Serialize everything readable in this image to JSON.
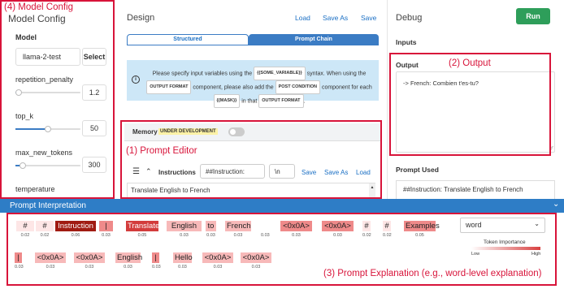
{
  "annotations": {
    "model_config": "(4) Model Config",
    "output": "(2) Output",
    "prompt_editor": "(1) Prompt Editor",
    "prompt_explanation": "(3) Prompt Explanation (e.g., word-level explanation)"
  },
  "config": {
    "title": "Model Config",
    "model_label": "Model",
    "model_value": "llama-2-test",
    "select_label": "Select",
    "params": [
      {
        "label": "repetition_penalty",
        "value": "1.2",
        "level": 0.05
      },
      {
        "label": "top_k",
        "value": "50",
        "level": 0.3
      },
      {
        "label": "max_new_tokens",
        "value": "300",
        "level": 0.1
      },
      {
        "label": "temperature",
        "value": "",
        "level": 0
      }
    ]
  },
  "design": {
    "title": "Design",
    "load": "Load",
    "save_as": "Save As",
    "save": "Save",
    "tab_structured": "Structured",
    "tab_chain": "Prompt Chain",
    "info_p1": "Please specify input variables using the",
    "info_tag1": "{{SOME_VARIABLE}}",
    "info_p2": "syntax. When using the",
    "info_tag2": "OUTPUT FORMAT",
    "info_p3": "component, please also add the",
    "info_tag3": "POST CONDITION",
    "info_p4": "component for each",
    "info_tag4": "{{MASK}}",
    "info_p5": "in that",
    "info_tag5": "OUTPUT FORMAT",
    "info_p6": ".",
    "memory_label": "Memory",
    "memory_badge": "UNDER DEVELOPMENT",
    "instr_label": "Instructions",
    "instr_field": "##Instruction:",
    "sep_field": "\\n",
    "instr_save": "Save",
    "instr_save_as": "Save As",
    "instr_load": "Load",
    "instr_text": "Translate English to French"
  },
  "debug": {
    "title": "Debug",
    "run": "Run",
    "inputs": "Inputs",
    "output_label": "Output",
    "output_text": "-> French: Combien t'es-tu?",
    "prompt_used_label": "Prompt Used",
    "prompt_used_text": "##Instruction: Translate English to French"
  },
  "interp": {
    "title": "Prompt Interpretation",
    "select_value": "word",
    "legend_title": "Token Importance",
    "legend_low": "Low",
    "legend_high": "High",
    "colors": {
      "high": "#a01b12",
      "mid": "#e25a5a",
      "low": "#fde3e3",
      "bar": "#3b7cc4"
    },
    "row1": [
      {
        "t": "#",
        "s": "0.02",
        "w": 0.02
      },
      {
        "t": "#",
        "s": "0.02",
        "w": 0.02
      },
      {
        "t": "Instruction",
        "s": "0.06",
        "w": 1.0
      },
      {
        "t": "|",
        "s": "0.03",
        "w": 0.6
      },
      {
        "t": "Translate",
        "s": "0.05",
        "w": 0.75
      },
      {
        "t": "English",
        "s": "0.03",
        "w": 0.45
      },
      {
        "t": "to",
        "s": "0.03",
        "w": 0.4
      },
      {
        "t": "French",
        "s": "0.03",
        "w": 0.45
      },
      {
        "t": "",
        "s": "0.03",
        "w": 0
      },
      {
        "t": "<0x0A>",
        "s": "0.03",
        "w": 0.5
      },
      {
        "t": "<0x0A>",
        "s": "0.03",
        "w": 0.5
      },
      {
        "t": "#",
        "s": "0.02",
        "w": 0.1
      },
      {
        "t": "#",
        "s": "0.02",
        "w": 0.1
      },
      {
        "t": "Examples",
        "s": "0.05",
        "w": 0.6
      }
    ],
    "row2": [
      {
        "t": "|",
        "s": "0.03",
        "w": 0.6
      },
      {
        "t": "<0x0A>",
        "s": "0.03",
        "w": 0.45
      },
      {
        "t": "<0x0A>",
        "s": "0.03",
        "w": 0.45
      },
      {
        "t": "English",
        "s": "0.03",
        "w": 0.3
      },
      {
        "t": "|",
        "s": "0.03",
        "w": 0.6
      },
      {
        "t": "Hello",
        "s": "0.03",
        "w": 0.3
      },
      {
        "t": "<0x0A>",
        "s": "0.03",
        "w": 0.4
      },
      {
        "t": "<0x0A>",
        "s": "0.03",
        "w": 0.4
      }
    ]
  }
}
